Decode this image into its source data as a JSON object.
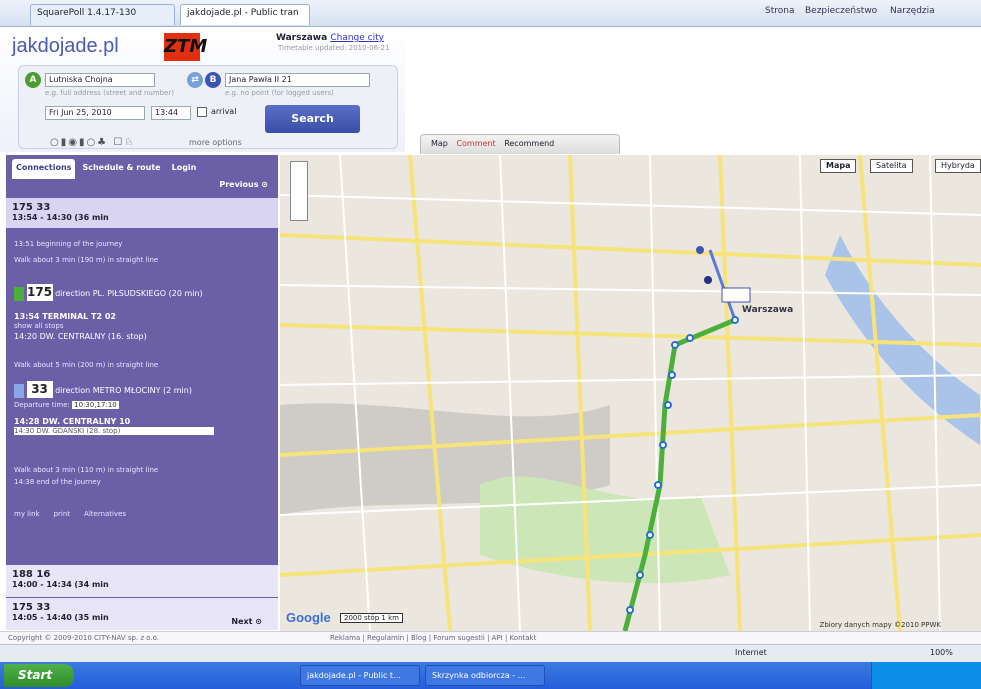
{
  "browser": {
    "tabs": [
      {
        "label": "SquarePoll 1.4.17-130"
      },
      {
        "label": "jakdojade.pl - Public tran"
      }
    ],
    "commands": [
      "Strona",
      "Bezpieczeństwo",
      "Narzędzia"
    ]
  },
  "header": {
    "logo": "jakdojade.pl",
    "brand_mark": "ZTM",
    "city_label": "Warszawa",
    "change_city": "Change city",
    "timetable_updated": "Timetable updated: 2010-06-21"
  },
  "form": {
    "from_value": "Lutniska Chojna",
    "to_value": "Jana Pawła II 21",
    "from_hint": "e.g. full address (street and number)",
    "to_hint": "e.g. no point (for logged users)",
    "date_value": "Fri Jun 25, 2010",
    "time_value": "13:44",
    "arrival_label": "arrival",
    "search_label": "Search",
    "more_options": "more options"
  },
  "sidebar": {
    "tabs": [
      "Connections",
      "Schedule & route",
      "Login"
    ],
    "previous_label": "Previous",
    "next_label": "Next",
    "connections": [
      {
        "lines": "175  33",
        "times": "13:54 - 14:30",
        "duration": "(36 min"
      },
      {
        "lines": "188  16",
        "times": "14:00 - 14:34",
        "duration": "(34 min"
      },
      {
        "lines": "175  33",
        "times": "14:05 - 14:40",
        "duration": "(35 min"
      }
    ],
    "detail": {
      "start": "13:51 beginning of the journey",
      "walk1": "Walk about 3 min (190 m) in straight line",
      "line1": "175",
      "line1_dir": "direction PL. PIŁSUDSKIEGO (20 min)",
      "stop1_from": "13:54 TERMINAL T2 02",
      "stop1_link": "show all stops",
      "stop1_to": "14:20 DW. CENTRALNY (16. stop)",
      "walk2": "Walk about 5 min (200 m) in straight line",
      "line2": "33",
      "line2_dir": "direction METRO MŁOCINY (2 min)",
      "departs": "Departure time:",
      "departs_times": "10:30,17:10",
      "stop2_from": "14:28 DW. CENTRALNY 10",
      "stop2_to": "14:30 DW. GDAŃSKI (28. stop)",
      "walk3": "Walk about 3 min (110 m) in straight line",
      "end": "14:38 end of the journey",
      "tools": [
        "my link",
        "print",
        "Alternatives"
      ]
    }
  },
  "map": {
    "tabs": [
      "Map",
      "Comment",
      "Recommend"
    ],
    "map_type_buttons": [
      "Mapa",
      "Satelita",
      "Hybryda"
    ],
    "scale_labels": [
      "2000 stóp",
      "1 km"
    ],
    "copyright": "Zbiory danych mapy ©2010 PPWK",
    "district_label": "Warszawa"
  },
  "footer": {
    "copyright": "Copyright © 2009-2010 CITY-NAV sp. z o.o.",
    "links": "Reklama | Regulamin | Blog | Forum sugestii | API | Kontakt"
  },
  "statusbar": {
    "zone": "Internet",
    "zoom": "100%"
  },
  "taskbar": {
    "start_label": "Start",
    "tasks": [
      "jakdojade.pl - Public t...",
      "Skrzynka odbiorcza - ..."
    ]
  }
}
